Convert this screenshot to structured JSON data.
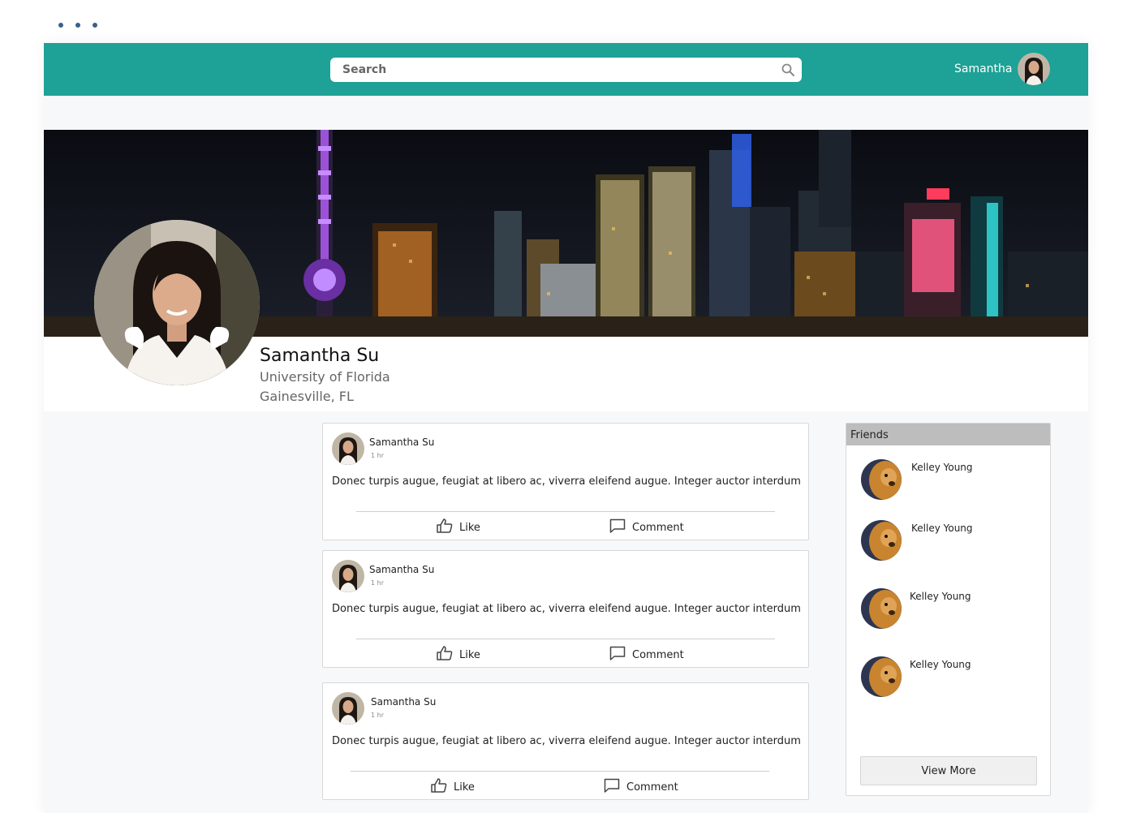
{
  "colors": {
    "topbar": "#1ea196",
    "accent": "#3a5f8a"
  },
  "header": {
    "search_placeholder": "Search",
    "user_name": "Samantha"
  },
  "profile": {
    "name": "Samantha Su",
    "school": "University of Florida",
    "location": "Gainesville, FL"
  },
  "posts": [
    {
      "author": "Samantha Su",
      "time": "1 hr",
      "text": "Donec turpis augue, feugiat at libero ac, viverra eleifend augue. Integer auctor interdum",
      "like_label": "Like",
      "comment_label": "Comment"
    },
    {
      "author": "Samantha Su",
      "time": "1 hr",
      "text": "Donec turpis augue, feugiat at libero ac, viverra eleifend augue. Integer auctor interdum",
      "like_label": "Like",
      "comment_label": "Comment"
    },
    {
      "author": "Samantha Su",
      "time": "1 hr",
      "text": "Donec turpis augue, feugiat at libero ac, viverra eleifend augue. Integer auctor interdum",
      "like_label": "Like",
      "comment_label": "Comment"
    }
  ],
  "friends": {
    "title": "Friends",
    "items": [
      {
        "name": "Kelley Young"
      },
      {
        "name": "Kelley Young"
      },
      {
        "name": "Kelley Young"
      },
      {
        "name": "Kelley Young"
      }
    ],
    "view_more_label": "View More"
  },
  "icons": [
    "window-dots-icon",
    "search-icon",
    "like-icon",
    "comment-icon"
  ]
}
